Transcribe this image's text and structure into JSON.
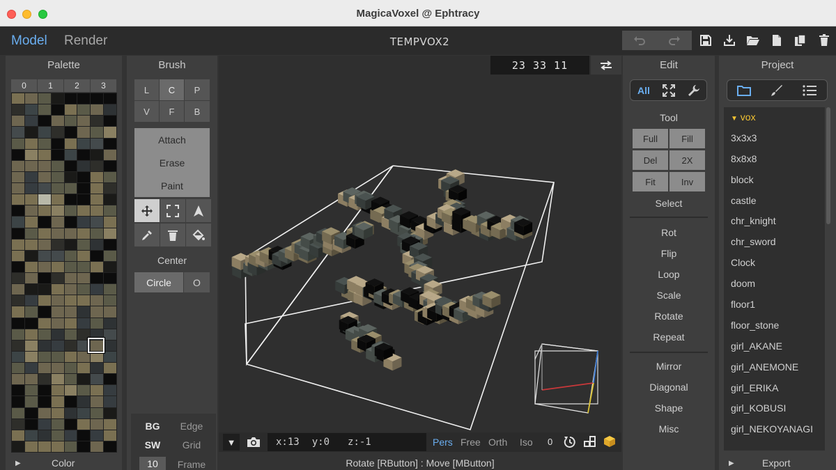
{
  "window": {
    "title": "MagicaVoxel @ Ephtracy"
  },
  "top": {
    "mode_model": "Model",
    "mode_render": "Render",
    "file_name": "TEMPVOX2"
  },
  "icons": {
    "undo": "undo-icon",
    "redo": "redo-icon",
    "save": "save-icon",
    "download": "download-icon",
    "open": "folder-open-icon",
    "new": "new-file-icon",
    "copy": "copy-icon",
    "delete": "trash-icon"
  },
  "palette": {
    "title": "Palette",
    "tabs": [
      "0",
      "1",
      "2",
      "3"
    ],
    "footer": "Color",
    "colors": [
      "#7a7052",
      "#6e6650",
      "#5a5a48",
      "#1a1a18",
      "#0c0c0c",
      "#0c0c0c",
      "#0c0c0c",
      "#0c0c0c",
      "#6e6650",
      "#363c40",
      "#7a7052",
      "#2e2e2a",
      "#5a5a48",
      "#3c4446",
      "#6e6650",
      "#5a5a48",
      "#444a4c",
      "#7a7052",
      "#6e6650",
      "#5a5a48",
      "#7a7052",
      "#2e3234",
      "#5a5a48",
      "#8a8062"
    ]
  },
  "brush": {
    "title": "Brush",
    "modes_row1": [
      "L",
      "C",
      "P"
    ],
    "modes_row2": [
      "V",
      "F",
      "B"
    ],
    "actions": [
      "Attach",
      "Erase",
      "Paint"
    ],
    "center_label": "Center",
    "circle_label": "Circle",
    "o_label": "O",
    "bottom": {
      "bg": "BG",
      "edge": "Edge",
      "sw": "SW",
      "grid": "Grid",
      "size": "10",
      "frame": "Frame"
    }
  },
  "viewport": {
    "coords": "23 33 11",
    "cursor": {
      "x": "x:13",
      "y": "y:0",
      "z": "z:-1"
    },
    "views": [
      "Pers",
      "Free",
      "Orth",
      "Iso"
    ],
    "zero": "0",
    "status": "Rotate [RButton] : Move [MButton]"
  },
  "edit": {
    "title": "Edit",
    "filters": [
      "All"
    ],
    "tool_label": "Tool",
    "tools": [
      [
        "Full",
        "Fill"
      ],
      [
        "Del",
        "2X"
      ],
      [
        "Fit",
        "Inv"
      ]
    ],
    "select_label": "Select",
    "transforms": [
      "Rot",
      "Flip",
      "Loop",
      "Scale",
      "Rotate",
      "Repeat"
    ],
    "extras": [
      "Mirror",
      "Diagonal",
      "Shape",
      "Misc"
    ]
  },
  "project": {
    "title": "Project",
    "folder": "vox",
    "items": [
      "3x3x3",
      "8x8x8",
      "block",
      "castle",
      "chr_knight",
      "chr_sword",
      "Clock",
      "doom",
      "floor1",
      "floor_stone",
      "girl_AKANE",
      "girl_ANEMONE",
      "girl_ERIKA",
      "girl_KOBUSI",
      "girl_NEKOYANAGI"
    ],
    "footer": "Export"
  },
  "colors": {
    "accent": "#6aaef0",
    "folder": "#f2c232",
    "panel": "#3e3e3e",
    "viewport": "#2f2f2f"
  }
}
